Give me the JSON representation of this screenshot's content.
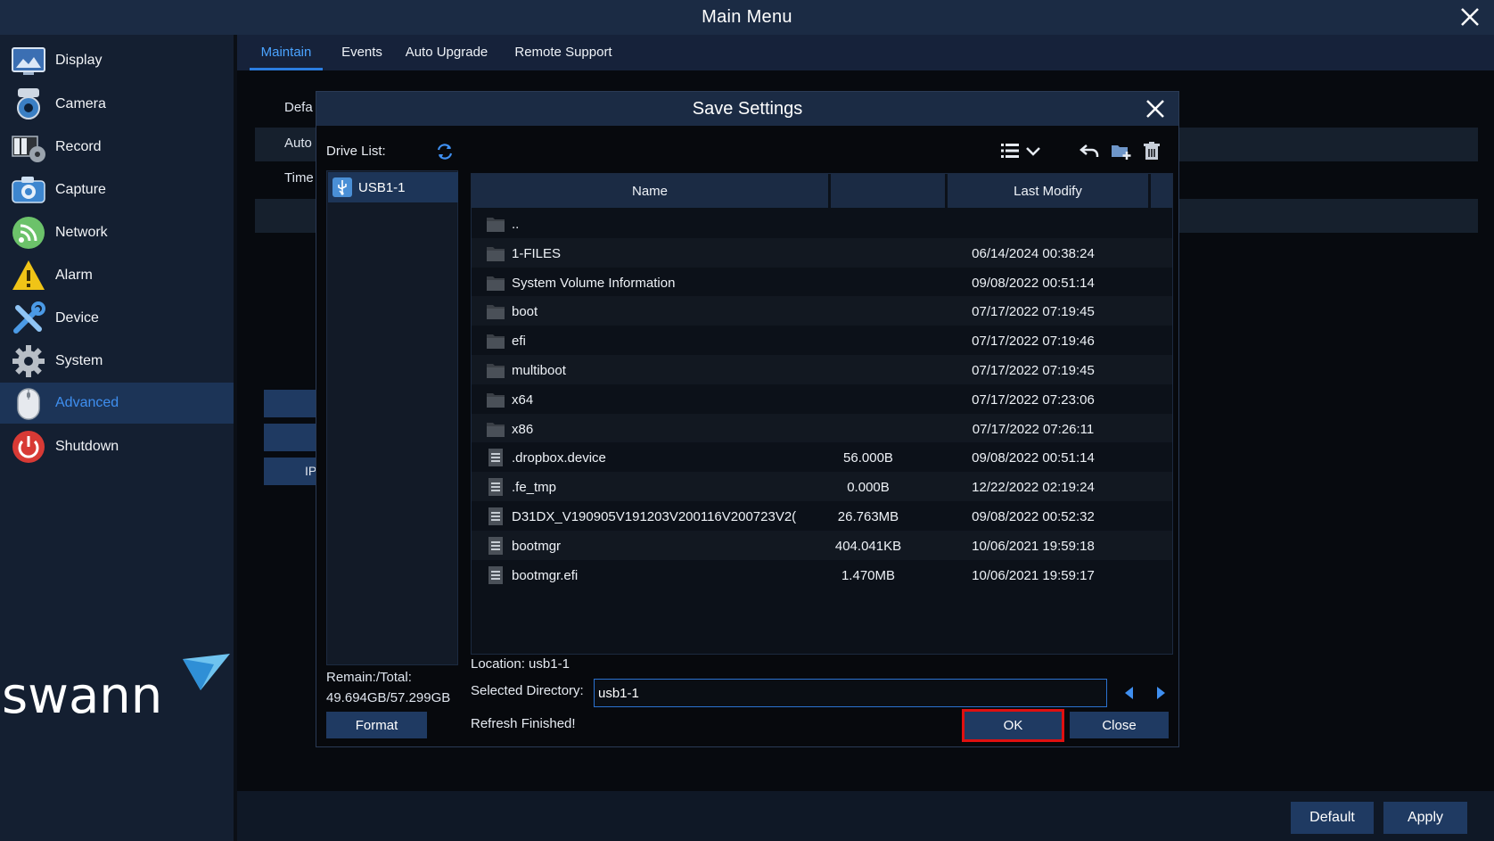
{
  "window": {
    "title": "Main Menu"
  },
  "sidebar": {
    "items": [
      {
        "label": "Display",
        "icon": "display-icon"
      },
      {
        "label": "Camera",
        "icon": "camera-icon"
      },
      {
        "label": "Record",
        "icon": "record-icon"
      },
      {
        "label": "Capture",
        "icon": "capture-icon"
      },
      {
        "label": "Network",
        "icon": "network-icon"
      },
      {
        "label": "Alarm",
        "icon": "alarm-icon"
      },
      {
        "label": "Device",
        "icon": "device-icon"
      },
      {
        "label": "System",
        "icon": "gear-icon"
      },
      {
        "label": "Advanced",
        "icon": "mouse-icon",
        "active": true
      },
      {
        "label": "Shutdown",
        "icon": "power-icon"
      }
    ],
    "logo_text": "swann"
  },
  "tabs": [
    {
      "label": "Maintain",
      "active": true
    },
    {
      "label": "Events"
    },
    {
      "label": "Auto Upgrade"
    },
    {
      "label": "Remote Support"
    }
  ],
  "background": {
    "row1_label": "Defa",
    "row2_label": "Auto",
    "row3_label": "Time",
    "btn3_label": "IP"
  },
  "main_buttons": {
    "default": "Default",
    "apply": "Apply"
  },
  "dialog": {
    "title": "Save Settings",
    "drive_list_label": "Drive List:",
    "drives": [
      {
        "label": "USB1-1"
      }
    ],
    "remain_label": "Remain:/Total:",
    "remain_value": "49.694GB/57.299GB",
    "format_label": "Format",
    "columns": {
      "name": "Name",
      "size": "",
      "modified": "Last Modify"
    },
    "files": [
      {
        "name": "..",
        "size": "",
        "modified": "",
        "type": "folder"
      },
      {
        "name": "1-FILES",
        "size": "",
        "modified": "06/14/2024 00:38:24",
        "type": "folder"
      },
      {
        "name": "System Volume Information",
        "size": "",
        "modified": "09/08/2022 00:51:14",
        "type": "folder"
      },
      {
        "name": "boot",
        "size": "",
        "modified": "07/17/2022 07:19:45",
        "type": "folder"
      },
      {
        "name": "efi",
        "size": "",
        "modified": "07/17/2022 07:19:46",
        "type": "folder"
      },
      {
        "name": "multiboot",
        "size": "",
        "modified": "07/17/2022 07:19:45",
        "type": "folder"
      },
      {
        "name": "x64",
        "size": "",
        "modified": "07/17/2022 07:23:06",
        "type": "folder"
      },
      {
        "name": "x86",
        "size": "",
        "modified": "07/17/2022 07:26:11",
        "type": "folder"
      },
      {
        "name": ".dropbox.device",
        "size": "56.000B",
        "modified": "09/08/2022 00:51:14",
        "type": "file"
      },
      {
        "name": ".fe_tmp",
        "size": "0.000B",
        "modified": "12/22/2022 02:19:24",
        "type": "file"
      },
      {
        "name": "D31DX_V190905V191203V200116V200723V2(",
        "size": "26.763MB",
        "modified": "09/08/2022 00:52:32",
        "type": "file"
      },
      {
        "name": "bootmgr",
        "size": "404.041KB",
        "modified": "10/06/2021 19:59:18",
        "type": "file"
      },
      {
        "name": "bootmgr.efi",
        "size": "1.470MB",
        "modified": "10/06/2021 19:59:17",
        "type": "file"
      }
    ],
    "location": "Location: usb1-1",
    "selected_dir_label": "Selected Directory:",
    "selected_dir_value": "usb1-1",
    "status": "Refresh Finished!",
    "ok_label": "OK",
    "close_label": "Close",
    "highlight_color": "#e01010"
  }
}
